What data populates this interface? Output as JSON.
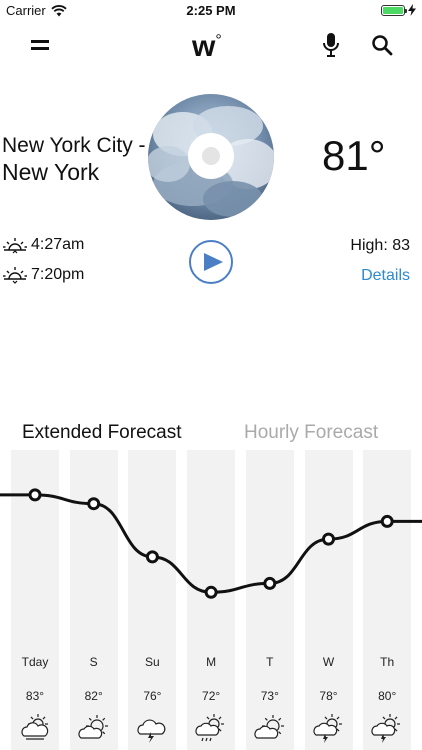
{
  "status_bar": {
    "carrier": "Carrier",
    "time": "2:25 PM",
    "battery_level": 1.0
  },
  "nav": {
    "logo": "w",
    "logo_sup": "°"
  },
  "current": {
    "city_line1": "New York City -",
    "city_line2": "New York",
    "temperature": "81°",
    "sunrise": "4:27am",
    "sunset": "7:20pm",
    "high": "High: 83",
    "details_label": "Details"
  },
  "tabs": {
    "extended": "Extended Forecast",
    "hourly": "Hourly Forecast"
  },
  "forecast": {
    "days": [
      {
        "label": "Tday",
        "temp": "83°",
        "value": 83,
        "icon": "cloudy-sun-icon"
      },
      {
        "label": "S",
        "temp": "82°",
        "value": 82,
        "icon": "partly-cloudy-icon"
      },
      {
        "label": "Su",
        "temp": "76°",
        "value": 76,
        "icon": "thunderstorm-icon"
      },
      {
        "label": "M",
        "temp": "72°",
        "value": 72,
        "icon": "rain-sun-icon"
      },
      {
        "label": "T",
        "temp": "73°",
        "value": 73,
        "icon": "partly-cloudy-icon"
      },
      {
        "label": "W",
        "temp": "78°",
        "value": 78,
        "icon": "thunder-sun-icon"
      },
      {
        "label": "Th",
        "temp": "80°",
        "value": 80,
        "icon": "thunder-sun-icon"
      }
    ]
  },
  "colors": {
    "accent_blue": "#2b8ad1",
    "play_blue": "#4a7fc5",
    "column_gray": "#f2f2f2",
    "inactive_tab": "#aaaaaa"
  }
}
